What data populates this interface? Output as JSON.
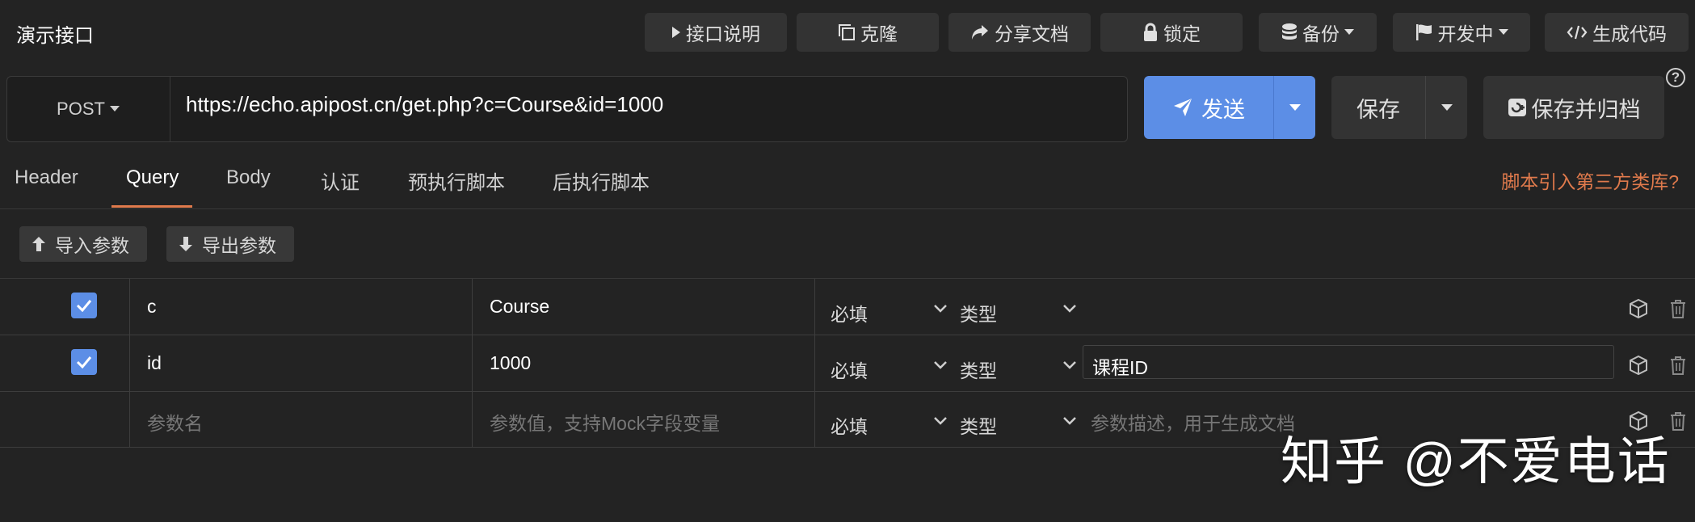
{
  "page": {
    "title": "演示接口"
  },
  "toolbar": {
    "doc_label": "接口说明",
    "clone_label": "克隆",
    "share_label": "分享文档",
    "lock_label": "锁定",
    "backup_label": "备份",
    "status_label": "开发中",
    "codegen_label": "生成代码"
  },
  "request": {
    "method": "POST",
    "url": "https://echo.apipost.cn/get.php?c=Course&id=1000",
    "send_label": "发送",
    "save_label": "保存",
    "save_archive_label": "保存并归档"
  },
  "tabs": [
    {
      "label": "Header"
    },
    {
      "label": "Query",
      "active": true
    },
    {
      "label": "Body"
    },
    {
      "label": "认证"
    },
    {
      "label": "预执行脚本"
    },
    {
      "label": "后执行脚本"
    }
  ],
  "third_party_link": "脚本引入第三方类库?",
  "params_toolbar": {
    "import_label": "导入参数",
    "export_label": "导出参数"
  },
  "params": {
    "required_label": "必填",
    "type_label": "类型",
    "rows": [
      {
        "checked": true,
        "name": "c",
        "value": "Course",
        "description": ""
      },
      {
        "checked": true,
        "name": "id",
        "value": "1000",
        "description": "课程ID"
      }
    ],
    "placeholder": {
      "name": "参数名",
      "value": "参数值，支持Mock字段变量",
      "description": "参数描述，用于生成文档"
    }
  },
  "help_icon": "?",
  "watermark": "知乎 @不爱电话",
  "colors": {
    "accent": "#5c8ee6",
    "link": "#e07a4c",
    "background": "#232323"
  }
}
